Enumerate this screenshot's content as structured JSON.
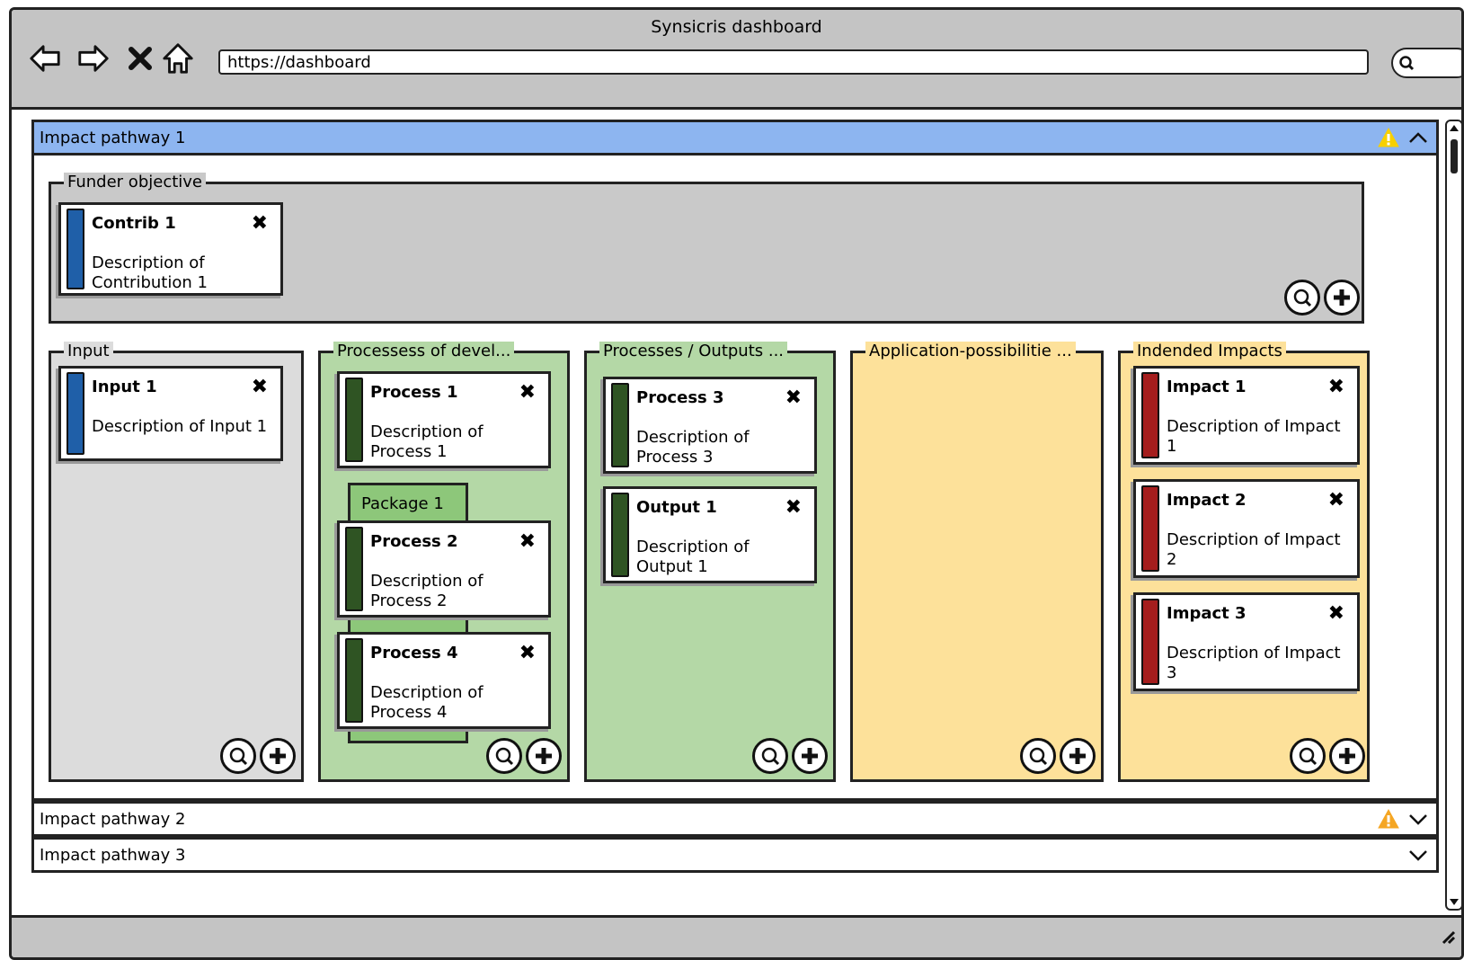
{
  "window": {
    "title": "Synsicris dashboard",
    "url": "https://dashboard"
  },
  "colors": {
    "blue": "#1f5fa8",
    "green": "#2f5423",
    "red": "#a51d1d",
    "accordion_open": "#8db5f0",
    "warning": "#f7c600"
  },
  "pathway1": {
    "title": "Impact pathway 1",
    "funder": {
      "label": "Funder objective",
      "cards": [
        {
          "title": "Contrib 1",
          "desc": "Description of Contribution 1"
        }
      ]
    },
    "input": {
      "label": "Input",
      "cards": [
        {
          "title": "Input 1",
          "desc": "Description of Input 1"
        }
      ]
    },
    "processes": {
      "label": "Processess of devel...",
      "package_label": "Package 1",
      "cards": [
        {
          "title": "Process 1",
          "desc": "Description of Process 1"
        },
        {
          "title": "Process 2",
          "desc": "Description of Process 2"
        },
        {
          "title": "Process 4",
          "desc": "Description of Process 4"
        }
      ]
    },
    "outputs": {
      "label": "Processes / Outputs ...",
      "cards": [
        {
          "title": "Process 3",
          "desc": "Description of Process 3"
        },
        {
          "title": "Output 1",
          "desc": "Description of Output 1"
        }
      ]
    },
    "applications": {
      "label": "Application-possibilitie ...",
      "cards": []
    },
    "impacts": {
      "label": "Indended Impacts",
      "cards": [
        {
          "title": "Impact 1",
          "desc": "Description of Impact 1"
        },
        {
          "title": "Impact 2",
          "desc": "Description of Impact 2"
        },
        {
          "title": "Impact 3",
          "desc": "Description of Impact 3"
        }
      ]
    }
  },
  "pathway2": {
    "title": "Impact pathway 2"
  },
  "pathway3": {
    "title": "Impact pathway 3"
  }
}
